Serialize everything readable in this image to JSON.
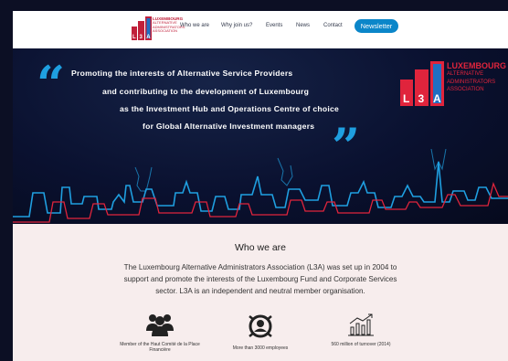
{
  "header": {
    "logo": {
      "line1": "LUXEMBOURG",
      "line2": "ALTERNATIVE",
      "line3": "ADMINISTRATORS",
      "line4": "ASSOCIATION",
      "mark": "L3A"
    },
    "nav": [
      {
        "label": "Who we are"
      },
      {
        "label": "Why join us?"
      },
      {
        "label": "Events"
      },
      {
        "label": "News"
      },
      {
        "label": "Contact"
      }
    ],
    "newsletter_label": "Newsletter"
  },
  "banner": {
    "lines": [
      "Promoting the interests of Alternative Service Providers",
      "and contributing to the development of Luxembourg",
      "as the Investment Hub and Operations Centre of choice",
      "for Global Alternative Investment managers"
    ],
    "logo": {
      "mark": "L3A",
      "line1": "LUXEMBOURG",
      "line2": "ALTERNATIVE",
      "line3": "ADMINISTRATORS",
      "line4": "ASSOCIATION"
    },
    "accent_blue": "#1f9fe0",
    "accent_red": "#e0243c"
  },
  "who_we_are": {
    "title": "Who we are",
    "intro": "The Luxembourg Alternative Administrators Association (L3A) was set up in 2004 to support and promote the interests of the Luxembourg Fund and Corporate Services sector. L3A is an independent and neutral member organisation.",
    "stats": [
      {
        "icon": "people-group-icon",
        "label": "Member of the Haut Comité de la Place Financière"
      },
      {
        "icon": "employee-badge-icon",
        "label": "More than 3000 employees"
      },
      {
        "icon": "bar-chart-growth-icon",
        "label": "560 million of turnover (2014)"
      }
    ]
  }
}
